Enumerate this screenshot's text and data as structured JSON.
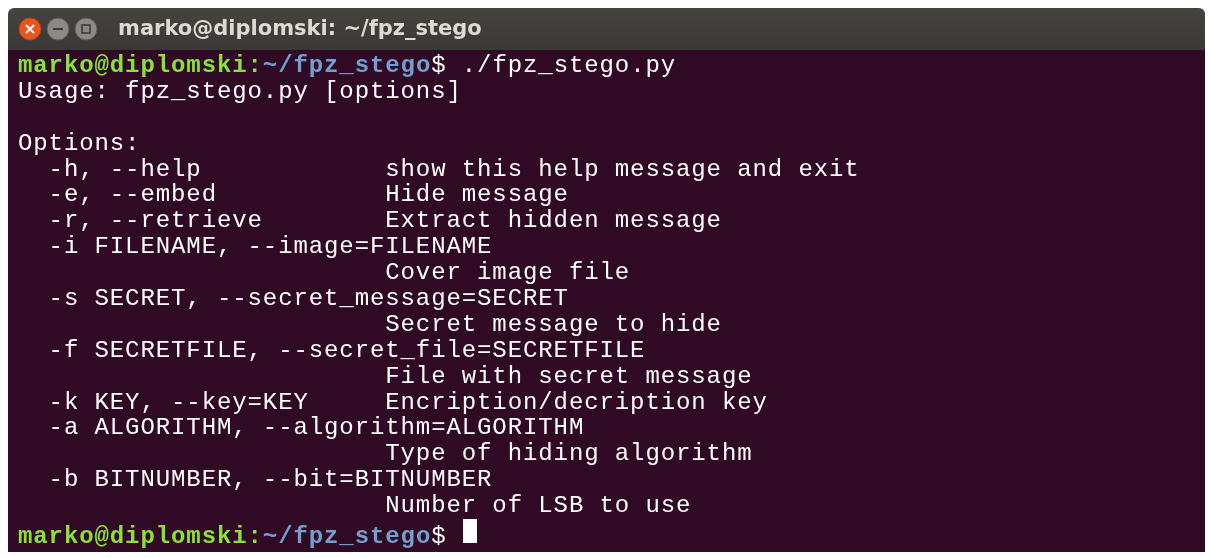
{
  "window": {
    "title": "marko@diplomski: ~/fpz_stego"
  },
  "terminal": {
    "lines": [
      {
        "kind": "prompt",
        "user_host": "marko@diplomski",
        "separator": ":",
        "path": "~/fpz_stego",
        "symbol": "$",
        "command": "./fpz_stego.py"
      },
      {
        "kind": "output",
        "text": "Usage: fpz_stego.py [options]"
      },
      {
        "kind": "blank"
      },
      {
        "kind": "output",
        "text": "Options:"
      },
      {
        "kind": "output",
        "text": "  -h, --help            show this help message and exit"
      },
      {
        "kind": "output",
        "text": "  -e, --embed           Hide message"
      },
      {
        "kind": "output",
        "text": "  -r, --retrieve        Extract hidden message"
      },
      {
        "kind": "output",
        "text": "  -i FILENAME, --image=FILENAME"
      },
      {
        "kind": "output",
        "text": "                        Cover image file"
      },
      {
        "kind": "output",
        "text": "  -s SECRET, --secret_message=SECRET"
      },
      {
        "kind": "output",
        "text": "                        Secret message to hide"
      },
      {
        "kind": "output",
        "text": "  -f SECRETFILE, --secret_file=SECRETFILE"
      },
      {
        "kind": "output",
        "text": "                        File with secret message"
      },
      {
        "kind": "output",
        "text": "  -k KEY, --key=KEY     Encription/decription key"
      },
      {
        "kind": "output",
        "text": "  -a ALGORITHM, --algorithm=ALGORITHM"
      },
      {
        "kind": "output",
        "text": "                        Type of hiding algorithm"
      },
      {
        "kind": "output",
        "text": "  -b BITNUMBER, --bit=BITNUMBER"
      },
      {
        "kind": "output",
        "text": "                        Number of LSB to use"
      },
      {
        "kind": "prompt",
        "user_host": "marko@diplomski",
        "separator": ":",
        "path": "~/fpz_stego",
        "symbol": "$",
        "cursor": true
      }
    ]
  }
}
